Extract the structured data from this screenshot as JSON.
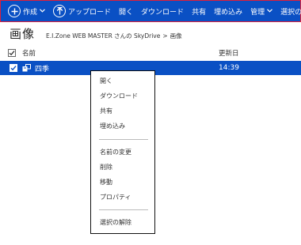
{
  "toolbar": {
    "create_label": "作成",
    "upload_label": "アップロード",
    "open_label": "開く",
    "download_label": "ダウンロード",
    "share_label": "共有",
    "embed_label": "埋め込み",
    "manage_label": "管理",
    "deselect_label": "選択の解除"
  },
  "header": {
    "title": "画像",
    "breadcrumb": {
      "owner": "E.I.Zone WEB MASTER さんの SkyDrive",
      "separator": ">",
      "current": "画像"
    }
  },
  "list": {
    "columns": {
      "name": "名前",
      "updated": "更新日"
    },
    "rows": [
      {
        "name": "四季",
        "updated": "14:39",
        "selected": true,
        "icon": "folder-icon"
      }
    ]
  },
  "context_menu": {
    "items": [
      "開く",
      "ダウンロード",
      "共有",
      "埋め込み",
      "名前の変更",
      "削除",
      "移動",
      "プロパティ",
      "選択の解除"
    ]
  },
  "colors": {
    "accent": "#0a50c4",
    "highlight_border": "#e0203a",
    "menu_border": "#111111"
  }
}
